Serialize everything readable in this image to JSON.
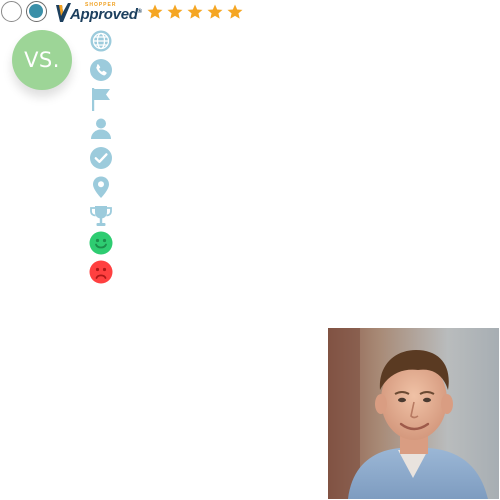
{
  "header": {
    "radio_buttons": [
      {
        "state": "unselected"
      },
      {
        "state": "selected"
      }
    ],
    "badge": {
      "top_text": "SHOPPER",
      "word": "Approved",
      "registered": "®"
    },
    "rating": {
      "stars": 5,
      "max": 5,
      "color": "#f5a623"
    }
  },
  "comparison": {
    "vs_label": "VS.",
    "vs_color": "#9dd597",
    "icons": [
      {
        "name": "globe-icon",
        "color": "#9ccbdc"
      },
      {
        "name": "phone-icon",
        "color": "#9ccbdc"
      },
      {
        "name": "flag-icon",
        "color": "#9ccbdc"
      },
      {
        "name": "user-icon",
        "color": "#9ccbdc"
      },
      {
        "name": "check-circle-icon",
        "color": "#9ccbdc"
      },
      {
        "name": "location-pin-icon",
        "color": "#9ccbdc"
      },
      {
        "name": "trophy-icon",
        "color": "#9ccbdc"
      },
      {
        "name": "happy-face-icon",
        "color": "#2ecc71"
      },
      {
        "name": "sad-face-icon",
        "color": "#ff4040"
      }
    ]
  },
  "profile": {
    "photo": "portrait-photo"
  }
}
